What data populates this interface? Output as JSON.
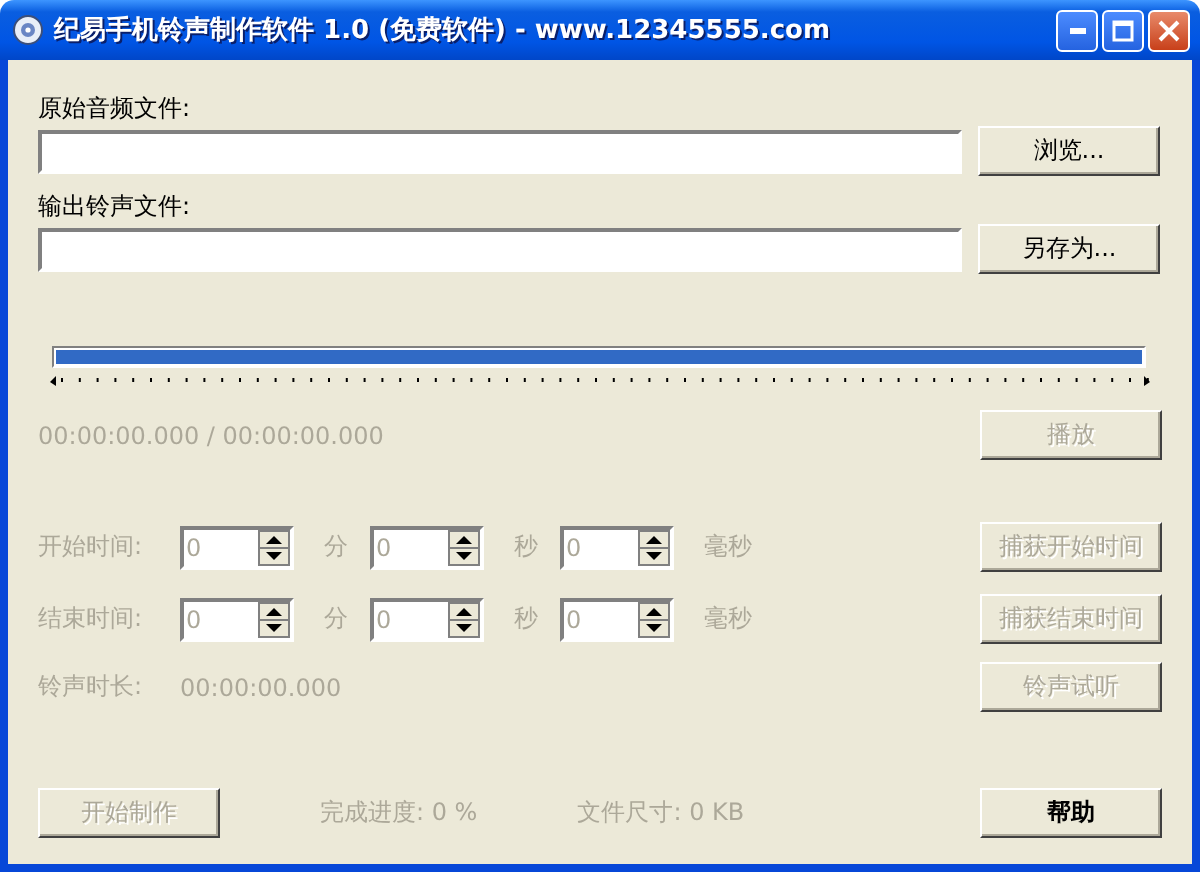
{
  "window": {
    "title": "纪易手机铃声制作软件 1.0 (免费软件) - www.12345555.com"
  },
  "source": {
    "label": "原始音频文件:",
    "button": {
      "label": "浏览...",
      "disabled": false
    }
  },
  "output": {
    "label": "输出铃声文件:",
    "button": {
      "label": "另存为...",
      "disabled": false
    }
  },
  "slider": {
    "level": 1
  },
  "position": {
    "text": "00:00:00.000 / 00:00:00.000",
    "disabled": true,
    "button": {
      "label": "播放",
      "disabled": true
    }
  },
  "time_rows": [
    {
      "label": "开始时间:",
      "disabled": true,
      "fields": [
        {
          "value": "0",
          "unit": "分"
        },
        {
          "value": "0",
          "unit": "秒"
        },
        {
          "value": "0",
          "unit": "毫秒"
        }
      ],
      "button": {
        "label": "捕获开始时间",
        "disabled": true
      }
    },
    {
      "label": "结束时间:",
      "disabled": true,
      "fields": [
        {
          "value": "0",
          "unit": "分"
        },
        {
          "value": "0",
          "unit": "秒"
        },
        {
          "value": "0",
          "unit": "毫秒"
        }
      ],
      "button": {
        "label": "捕获结束时间",
        "disabled": true
      }
    }
  ],
  "duration": {
    "label": "铃声时长:",
    "value": "00:00:00.000",
    "disabled": true,
    "button": {
      "label": "铃声试听",
      "disabled": true
    }
  },
  "footer": {
    "start_button": {
      "label": "开始制作",
      "disabled": true
    },
    "progress": "完成进度: 0 %",
    "file_size": "文件尺寸: 0 KB",
    "disabled": true,
    "help_button": {
      "label": "帮助",
      "disabled": false
    }
  }
}
